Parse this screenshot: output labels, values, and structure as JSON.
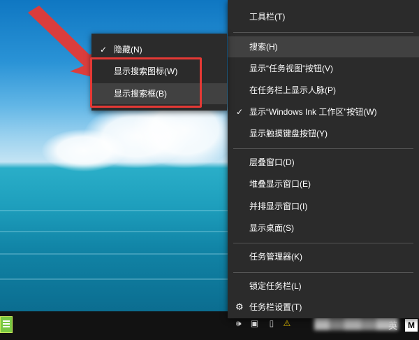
{
  "context_menu": {
    "items": [
      {
        "label": "工具栏(T)"
      },
      {
        "label": "搜索(H)"
      },
      {
        "label": "显示“任务视图”按钮(V)"
      },
      {
        "label": "在任务栏上显示人脉(P)"
      },
      {
        "label": "显示“Windows Ink 工作区”按钮(W)"
      },
      {
        "label": "显示触摸键盘按钮(Y)"
      },
      {
        "label": "层叠窗口(D)"
      },
      {
        "label": "堆叠显示窗口(E)"
      },
      {
        "label": "并排显示窗口(I)"
      },
      {
        "label": "显示桌面(S)"
      },
      {
        "label": "任务管理器(K)"
      },
      {
        "label": "锁定任务栏(L)"
      },
      {
        "label": "任务栏设置(T)"
      }
    ]
  },
  "search_submenu": {
    "items": [
      {
        "label": "隐藏(N)"
      },
      {
        "label": "显示搜索图标(W)"
      },
      {
        "label": "显示搜索框(B)"
      }
    ]
  },
  "tray": {
    "lang": "英",
    "ime": "M"
  },
  "icons": {
    "check": "checkmark-icon",
    "settings": "gear-icon",
    "annotation_arrow": "red-arrow-icon"
  },
  "colors": {
    "menu_bg": "#2b2b2b",
    "highlight": "#414141",
    "annotation_red": "#e53935"
  }
}
